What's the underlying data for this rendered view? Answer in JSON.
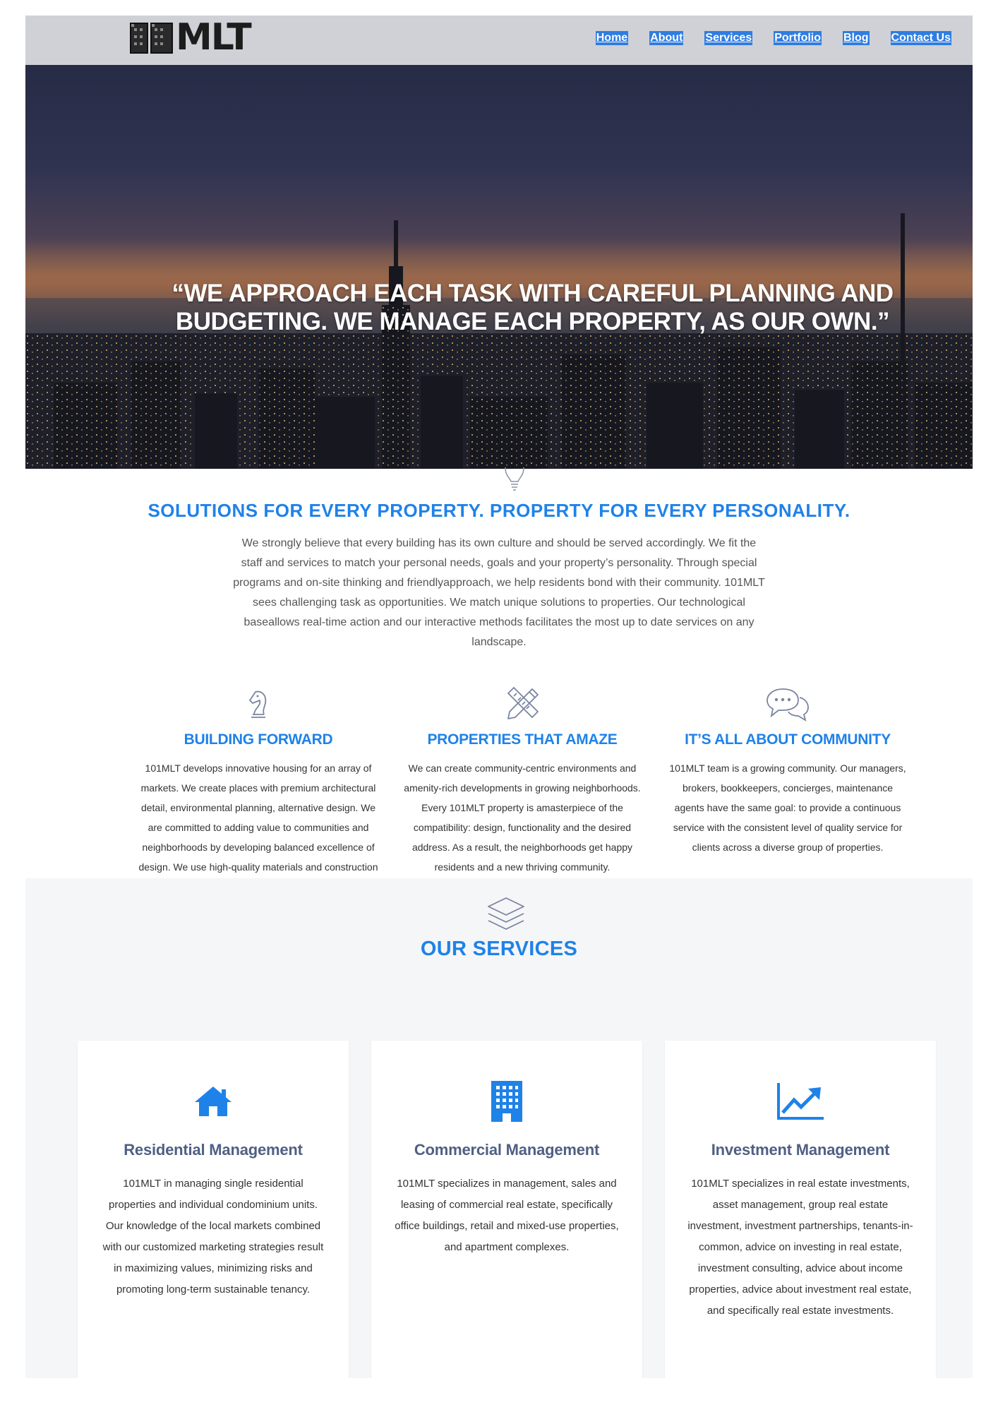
{
  "header": {
    "logo_text": "MLT",
    "nav": [
      "Home",
      "About",
      "Services",
      "Portfolio",
      "Blog",
      "Contact Us"
    ]
  },
  "hero": {
    "quote_line1": "“WE APPROACH EACH TASK WITH CAREFUL PLANNING AND",
    "quote_line2": "BUDGETING. WE MANAGE EACH PROPERTY, AS OUR OWN.”"
  },
  "solutions": {
    "icon": "lightbulb-icon",
    "title": "SOLUTIONS FOR EVERY PROPERTY. PROPERTY FOR EVERY PERSONALITY.",
    "text": "We strongly believe that every building has its own culture and should be served accordingly. We fit the staff and services to match your personal needs, goals and your property’s personality. Through special programs and on-site thinking and friendlyapproach, we help residents bond with their community. 101MLT sees challenging task as opportunities. We match unique solutions to properties. Our technological baseallows real-time action and our interactive methods facilitates the most up to date services on any landscape."
  },
  "features": [
    {
      "icon": "chess-knight-icon",
      "title": "BUILDING FORWARD",
      "text": "101MLT develops innovative housing for an array of markets. We create places with premium architectural detail, environmental planning, alternative design. We are committed to adding value to communities and neighborhoods by developing balanced excellence of design. We use high-quality materials and construction methods."
    },
    {
      "icon": "pencil-ruler-icon",
      "title": "PROPERTIES THAT AMAZE",
      "text": "We can create community-centric environments and amenity-rich developments in growing neighborhoods. Every 101MLT property is amasterpiece of the compatibility: design, functionality and the desired address. As a result, the neighborhoods get happy residents and a new thriving community."
    },
    {
      "icon": "chat-bubbles-icon",
      "title": "IT’S ALL ABOUT COMMUNITY",
      "text": "101MLT team is a growing community. Our managers, brokers, bookkeepers, concierges, maintenance agents have the same goal: to provide a continuous service with the consistent level of quality service for clients across a diverse group of properties."
    }
  ],
  "services": {
    "icon": "layers-icon",
    "title": "OUR SERVICES",
    "cards": [
      {
        "icon": "home-icon",
        "title": "Residential Management",
        "text": "101MLT in managing single residential properties and individual condominium units. Our knowledge of the local markets combined with our customized marketing strategies result in maximizing values, minimizing risks and promoting long-term sustainable tenancy."
      },
      {
        "icon": "office-building-icon",
        "title": "Commercial Management",
        "text": "101MLT specializes in management, sales and leasing of commercial real estate, specifically office buildings, retail and mixed-use properties, and apartment complexes."
      },
      {
        "icon": "trending-up-chart-icon",
        "title": "Investment Management",
        "text": "101MLT specializes in real estate investments, asset management, group real estate investment, investment partnerships, tenants-in-common, advice on investing in real estate, investment consulting, advice about income properties, advice about investment real estate, and specifically real estate investments."
      }
    ]
  },
  "colors": {
    "accent": "#1f82e8",
    "nav_highlight": "#2f7de1",
    "header_bg": "#cfd1d6",
    "card_title": "#4f6083",
    "services_bg": "#f5f6f8"
  }
}
